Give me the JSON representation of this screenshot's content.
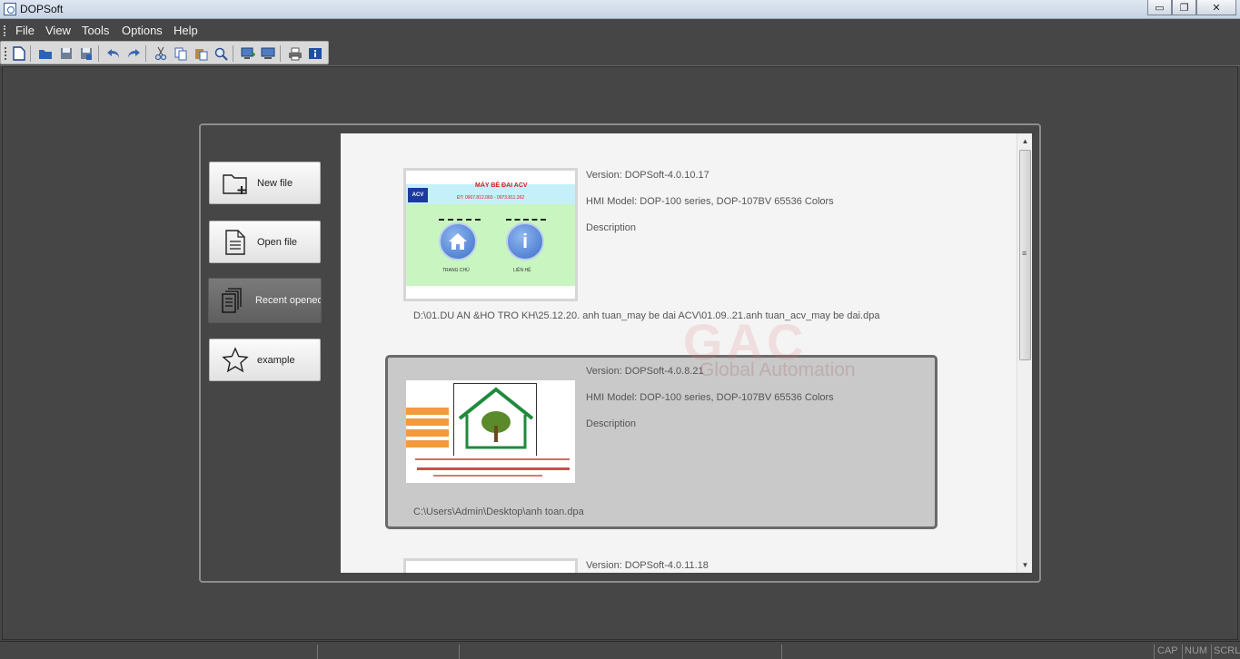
{
  "window": {
    "title": "DOPSoft",
    "minimize": "▭",
    "maximize": "❐",
    "close": "✕"
  },
  "menu": [
    "File",
    "View",
    "Tools",
    "Options",
    "Help"
  ],
  "toolbar": [
    "new-file-icon",
    "open-folder-icon",
    "save-icon",
    "save-as-icon",
    "undo-icon",
    "redo-icon",
    "cut-icon",
    "copy-icon",
    "paste-icon",
    "find-icon",
    "screen-add-icon",
    "screen-manager-icon",
    "print-icon",
    "about-info-icon"
  ],
  "sidebar": {
    "new_file": "New file",
    "open_file": "Open file",
    "recent_opened": "Recent opened",
    "example": "example",
    "active": "recent_opened"
  },
  "recent": [
    {
      "version": "Version: DOPSoft-4.0.10.17",
      "model": "HMI Model: DOP-100 series, DOP-107BV 65536 Colors",
      "description": "Description",
      "path": "D:\\01.DU AN &HO TRO KH\\25.12.20. anh tuan_may be dai ACV\\01.09..21.anh tuan_acv_may be dai.dpa",
      "thumb_title": "MÁY BẺ ĐAI ACV",
      "thumb_sub": "ĐT: 0907.812.060 - 0973.811.362",
      "thumb_logo": "ACV",
      "thumb_home": "TRANG CHỦ",
      "thumb_info": "LIÊN HỆ"
    },
    {
      "version": "Version: DOPSoft-4.0.8.21",
      "model": "HMI Model: DOP-100 series, DOP-107BV 65536 Colors",
      "description": "Description",
      "path": "C:\\Users\\Admin\\Desktop\\anh toan.dpa",
      "selected": true
    },
    {
      "version": "Version: DOPSoft-4.0.11.18"
    }
  ],
  "watermark": {
    "logo": "GAC",
    "text": "Global Automation"
  },
  "status": {
    "cap": "CAP",
    "num": "NUM",
    "scrl": "SCRL"
  }
}
